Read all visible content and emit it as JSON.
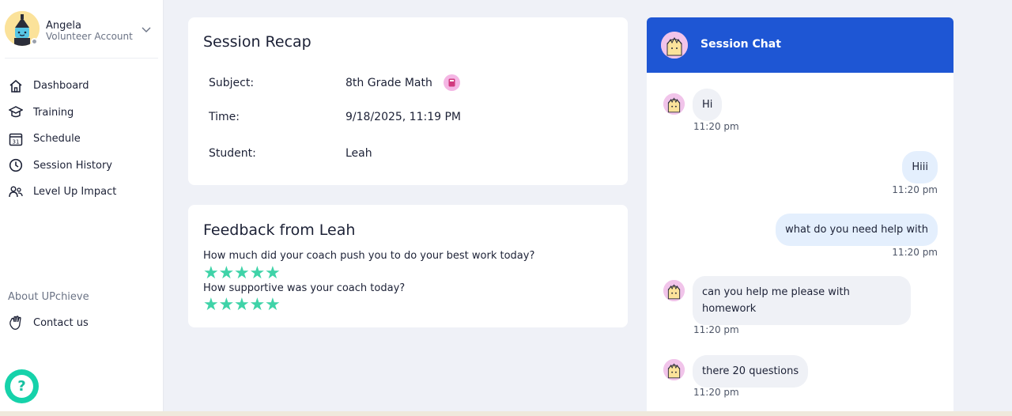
{
  "user": {
    "name": "Angela",
    "role": "Volunteer Account"
  },
  "nav": [
    {
      "label": "Dashboard",
      "icon": "home-icon"
    },
    {
      "label": "Training",
      "icon": "graduation-cap-icon"
    },
    {
      "label": "Schedule",
      "icon": "calendar-icon",
      "icon_text": "31"
    },
    {
      "label": "Session History",
      "icon": "clock-icon"
    },
    {
      "label": "Level Up Impact",
      "icon": "people-impact-icon"
    }
  ],
  "footer": {
    "about": "About UPchieve",
    "contact": "Contact us",
    "help_glyph": "?"
  },
  "recap": {
    "title": "Session Recap",
    "rows": [
      {
        "label": "Subject:",
        "value": "8th Grade Math"
      },
      {
        "label": "Time:",
        "value": "9/18/2025, 11:19 PM"
      },
      {
        "label": "Student:",
        "value": "Leah"
      }
    ]
  },
  "feedback": {
    "title": "Feedback from Leah",
    "questions": [
      {
        "text": "How much did your coach push you to do your best work today?",
        "rating": 5,
        "max": 5
      },
      {
        "text": "How supportive was your coach today?",
        "rating": 5,
        "max": 5
      }
    ]
  },
  "chat": {
    "title": "Session Chat",
    "messages": [
      {
        "text": "Hi",
        "time": "11:20 pm",
        "from": "student"
      },
      {
        "text": "Hiii",
        "time": "11:20 pm",
        "from": "volunteer"
      },
      {
        "text": "what do you need help with",
        "time": "11:20 pm",
        "from": "volunteer"
      },
      {
        "text": "can you help me please with homework",
        "time": "11:20 pm",
        "from": "student"
      },
      {
        "text": "there 20 questions",
        "time": "11:20 pm",
        "from": "student"
      }
    ]
  },
  "colors": {
    "accent": "#1e56d4",
    "help": "#16d2aa",
    "star": "#3fd3a8",
    "bubble_in": "#eff1f6",
    "bubble_out": "#e4effd"
  }
}
